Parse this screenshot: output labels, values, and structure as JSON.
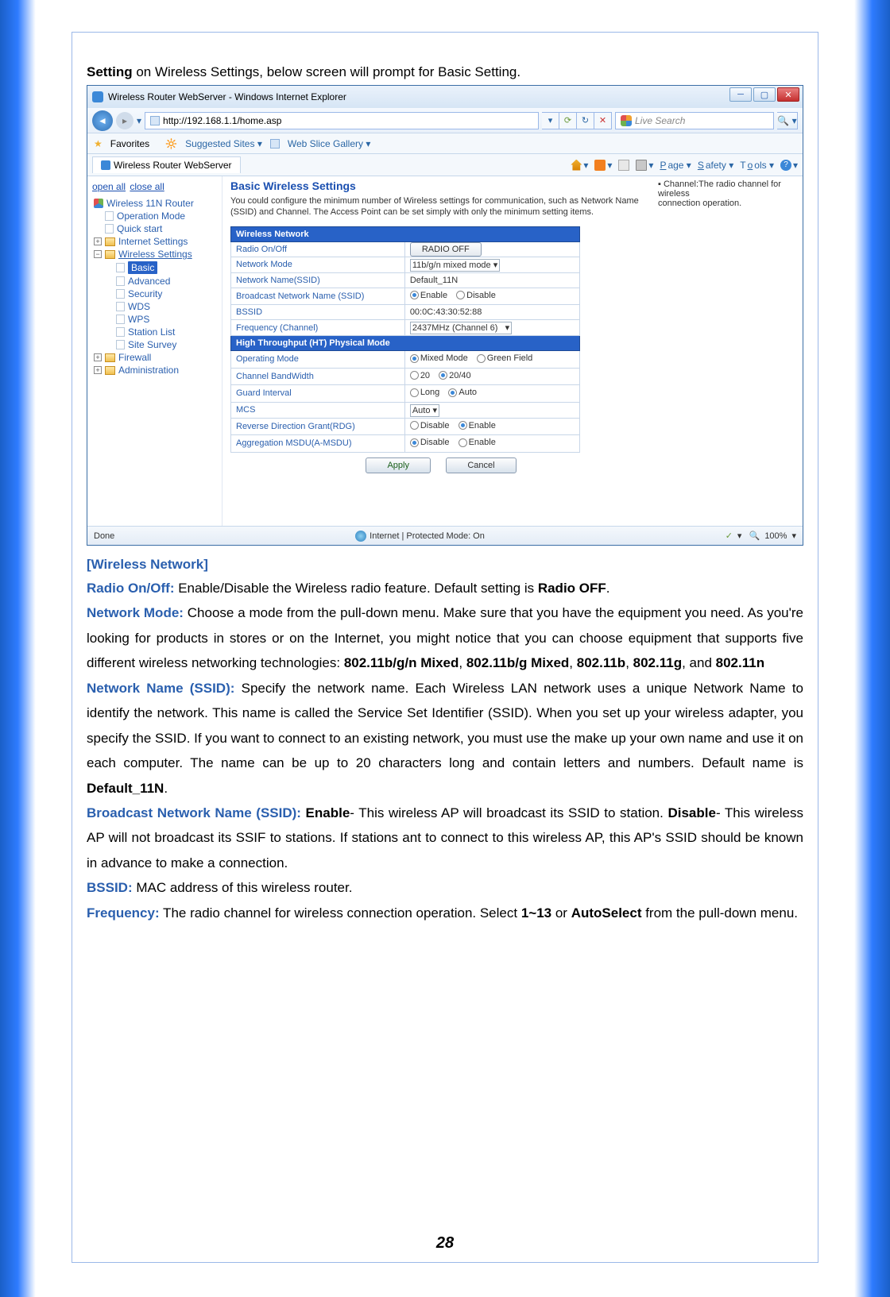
{
  "intro": {
    "bold": "Setting",
    "rest": " on Wireless Settings, below screen will prompt for Basic Setting."
  },
  "window": {
    "title": "Wireless Router WebServer - Windows Internet Explorer",
    "url": "http://192.168.1.1/home.asp",
    "search_placeholder": "Live Search",
    "fav_label": "Favorites",
    "suggested": "Suggested Sites",
    "gallery": "Web Slice Gallery",
    "tab_title": "Wireless Router WebServer",
    "toolbar": {
      "page": "Page",
      "safety": "Safety",
      "tools": "Tools"
    },
    "sidebar": {
      "open_all": "open all",
      "close_all": "close all",
      "root": "Wireless 11N Router",
      "items_top": [
        "Operation Mode",
        "Quick start"
      ],
      "internet": "Internet Settings",
      "wireless": "Wireless Settings",
      "wireless_items": [
        "Basic",
        "Advanced",
        "Security",
        "WDS",
        "WPS",
        "Station List",
        "Site Survey"
      ],
      "firewall": "Firewall",
      "admin": "Administration"
    },
    "panel": {
      "title": "Basic Wireless Settings",
      "description": "You could configure the minimum number of Wireless settings for communication, such as Network Name (SSID) and Channel. The Access Point can be set simply with only the minimum setting items.",
      "section1": "Wireless Network",
      "rows1": {
        "radio": "Radio On/Off",
        "radio_btn": "RADIO OFF",
        "mode": "Network Mode",
        "mode_val": "11b/g/n mixed mode",
        "ssid": "Network Name(SSID)",
        "ssid_val": "Default_11N",
        "bcast": "Broadcast Network Name (SSID)",
        "bssid": "BSSID",
        "bssid_val": "00:0C:43:30:52:88",
        "freq": "Frequency (Channel)",
        "freq_val": "2437MHz (Channel 6)"
      },
      "section2": "High Throughput (HT) Physical Mode",
      "rows2": {
        "op": "Operating Mode",
        "op_a": "Mixed Mode",
        "op_b": "Green Field",
        "bw": "Channel BandWidth",
        "bw_a": "20",
        "bw_b": "20/40",
        "gi": "Guard Interval",
        "gi_a": "Long",
        "gi_b": "Auto",
        "mcs": "MCS",
        "mcs_val": "Auto",
        "rdg": "Reverse Direction Grant(RDG)",
        "msdu": "Aggregation MSDU(A-MSDU)"
      },
      "enable": "Enable",
      "disable": "Disable",
      "apply": "Apply",
      "cancel": "Cancel",
      "sidecol": {
        "line1": "Channel:The radio channel for wireless",
        "line2": "connection operation."
      }
    },
    "status": {
      "done": "Done",
      "mode": "Internet | Protected Mode: On",
      "zoom": "100%"
    }
  },
  "doc": {
    "h1": "[Wireless Network]",
    "radio_label": "Radio On/Off:",
    "radio_text": " Enable/Disable the Wireless radio feature. Default setting is ",
    "radio_bold": "Radio OFF",
    "mode_label": "Network Mode:",
    "mode_text": " Choose a mode from the pull-down menu. Make sure that you have the equipment you need. As you're looking for products in stores or on the Internet, you might notice that you can choose equipment that supports five different wireless networking technologies: ",
    "mode_b1": "802.11b/g/n Mixed",
    "mode_b2": "802.11b/g Mixed",
    "mode_b3": "802.11b",
    "mode_b4": "802.11g",
    "mode_b5": "802.11n",
    "ssid_label": "Network Name (SSID):",
    "ssid_text": " Specify the network name. Each Wireless LAN network uses a unique Network Name to identify the network. This name is called the Service Set Identifier (SSID). When you set up your wireless adapter, you specify the SSID. If you want to connect to an existing network, you must use the make up your own name and use it on each computer. The name can be up to 20 characters long and contain letters and numbers. Default name is ",
    "ssid_bold": "Default_11N",
    "bcast_label": "Broadcast Network Name (SSID):",
    "bcast_en": " Enable",
    "bcast_en_text": "- This wireless AP will broadcast its SSID to station. ",
    "bcast_dis": "Disable",
    "bcast_dis_text": "- This wireless AP will not broadcast its SSIF to stations. If stations ant to connect to this wireless AP, this AP's SSID should be known in advance to make a connection.",
    "bssid_label": "BSSID:",
    "bssid_text": " MAC address of this wireless router.",
    "freq_label": "Frequency:",
    "freq_text": " The radio channel for wireless connection operation. Select ",
    "freq_b1": "1~13",
    "freq_or": " or ",
    "freq_b2": "AutoSelect",
    "freq_rest": " from the pull-down menu."
  },
  "page_number": "28"
}
